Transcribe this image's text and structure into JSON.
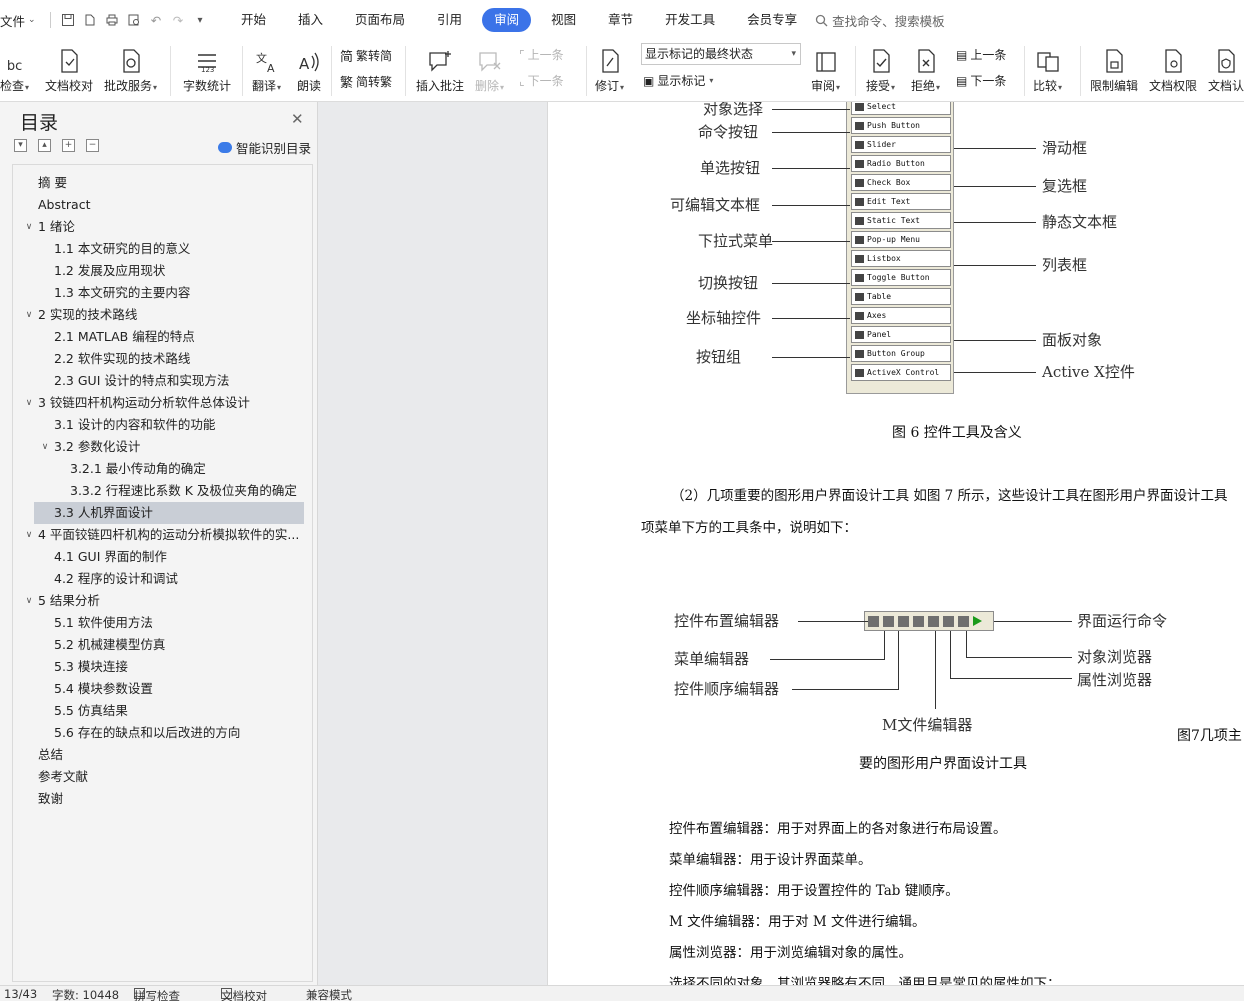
{
  "menubar": {
    "file": "文件",
    "tabs": [
      "开始",
      "插入",
      "页面布局",
      "引用",
      "审阅",
      "视图",
      "章节",
      "开发工具",
      "会员专享"
    ],
    "active_tab": "审阅",
    "search": "查找命令、搜索模板"
  },
  "ribbon": {
    "spell_check": "检查",
    "doc_proof": "文档校对",
    "review_service": "批改服务",
    "word_count": "字数统计",
    "translate": "翻译",
    "read_aloud": "朗读",
    "trad_to_simp": "繁转简",
    "simp_to_trad": "简转繁",
    "insert_comment": "插入批注",
    "delete": "删除",
    "prev_comment": "上一条",
    "next_comment": "下一条",
    "track_changes": "修订",
    "markup_mode": "显示标记的最终状态",
    "show_markup": "显示标记",
    "review_pane": "审阅",
    "accept": "接受",
    "reject": "拒绝",
    "prev_change": "上一条",
    "next_change": "下一条",
    "compare": "比较",
    "restrict_editing": "限制编辑",
    "doc_permissions": "文档权限",
    "doc_auth": "文档认"
  },
  "toc": {
    "title": "目录",
    "smart_toc": "智能识别目录",
    "items": [
      {
        "label": "摘  要",
        "level": 1,
        "expandable": false
      },
      {
        "label": "Abstract",
        "level": 1,
        "expandable": false
      },
      {
        "label": "1  绪论",
        "level": 1,
        "expandable": true
      },
      {
        "label": "1.1  本文研究的目的意义",
        "level": 2,
        "expandable": false
      },
      {
        "label": "1.2  发展及应用现状",
        "level": 2,
        "expandable": false
      },
      {
        "label": "1.3  本文研究的主要内容",
        "level": 2,
        "expandable": false
      },
      {
        "label": "2  实现的技术路线",
        "level": 1,
        "expandable": true
      },
      {
        "label": "2.1 MATLAB 编程的特点",
        "level": 2,
        "expandable": false
      },
      {
        "label": "2.2  软件实现的技术路线",
        "level": 2,
        "expandable": false
      },
      {
        "label": "2.3 GUI 设计的特点和实现方法",
        "level": 2,
        "expandable": false
      },
      {
        "label": "3  铰链四杆机构运动分析软件总体设计",
        "level": 1,
        "expandable": true
      },
      {
        "label": "3.1  设计的内容和软件的功能",
        "level": 2,
        "expandable": false
      },
      {
        "label": "3.2  参数化设计",
        "level": 2,
        "expandable": true
      },
      {
        "label": "3.2.1  最小传动角的确定",
        "level": 3,
        "expandable": false
      },
      {
        "label": "3.3.2  行程速比系数 K 及极位夹角的确定",
        "level": 3,
        "expandable": false
      },
      {
        "label": "3.3  人机界面设计",
        "level": 2,
        "expandable": false,
        "selected": true
      },
      {
        "label": "4  平面铰链四杆机构的运动分析模拟软件的实...",
        "level": 1,
        "expandable": true
      },
      {
        "label": "4.1 GUI 界面的制作",
        "level": 2,
        "expandable": false
      },
      {
        "label": "4.2  程序的设计和调试",
        "level": 2,
        "expandable": false
      },
      {
        "label": "5  结果分析",
        "level": 1,
        "expandable": true
      },
      {
        "label": "5.1  软件使用方法",
        "level": 2,
        "expandable": false
      },
      {
        "label": "5.2  机械建模型仿真",
        "level": 2,
        "expandable": false
      },
      {
        "label": "5.3  模块连接",
        "level": 2,
        "expandable": false
      },
      {
        "label": "5.4  模块参数设置",
        "level": 2,
        "expandable": false
      },
      {
        "label": "5.5  仿真结果",
        "level": 2,
        "expandable": false
      },
      {
        "label": "5.6  存在的缺点和以后改进的方向",
        "level": 2,
        "expandable": false
      },
      {
        "label": "总结",
        "level": 1,
        "expandable": false
      },
      {
        "label": "参考文献",
        "level": 1,
        "expandable": false
      },
      {
        "label": "致谢",
        "level": 1,
        "expandable": false
      }
    ]
  },
  "figure6": {
    "left_labels": [
      "对象选择",
      "命令按钮",
      "单选按钮",
      "可编辑文本框",
      "下拉式菜单",
      "切换按钮",
      "坐标轴控件",
      "按钮组"
    ],
    "right_labels": [
      "滑动框",
      "复选框",
      "静态文本框",
      "列表框",
      "面板对象",
      "Active  X控件"
    ],
    "palette_items": [
      "Select",
      "Push Button",
      "Slider",
      "Radio Button",
      "Check Box",
      "Edit Text",
      "Static Text",
      "Pop-up Menu",
      "Listbox",
      "Toggle Button",
      "Table",
      "Axes",
      "Panel",
      "Button Group",
      "ActiveX Control"
    ],
    "caption": "图 6 控件工具及含义"
  },
  "paragraph1": {
    "line1": "（2）几项重要的图形用户界面设计工具    如图 7 所示，这些设计工具在图形用户界面设计工具",
    "line2": "项菜单下方的工具条中，说明如下："
  },
  "figure7": {
    "labels": {
      "layout_editor": "控件布置编辑器",
      "menu_editor": "菜单编辑器",
      "tab_order_editor": "控件顺序编辑器",
      "m_file_editor": "M文件编辑器",
      "run_command": "界面运行命令",
      "object_browser": "对象浏览器",
      "property_inspector": "属性浏览器"
    },
    "caption_part1": "图7几项主",
    "caption_part2": "要的图形用户界面设计工具"
  },
  "definitions": [
    "控件布置编辑器：用于对界面上的各对象进行布局设置。",
    "菜单编辑器：用于设计界面菜单。",
    "控件顺序编辑器：用于设置控件的 Tab 键顺序。",
    "M 文件编辑器：用于对 M 文件进行编辑。",
    "属性浏览器：用于浏览编辑对象的属性。",
    "选择不同的对象，其浏览器略有不同，通用且是常见的属性如下："
  ],
  "statusbar": {
    "page": "13/43",
    "word_count": "字数: 10448",
    "spell_check": "拼写检查",
    "doc_proof": "文档校对",
    "compat_mode": "兼容模式"
  },
  "colors": {
    "accent": "#3b73e8",
    "selected_row": "#c9ced6"
  }
}
